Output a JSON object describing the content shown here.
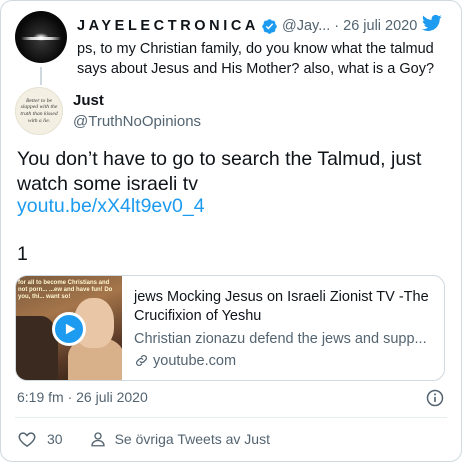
{
  "parent_tweet": {
    "display_name": "JAYELECTRONICA",
    "handle": "@Jay...",
    "separator": "·",
    "date": "26 juli 2020",
    "text": "ps, to my Christian family, do you know what the talmud says about Jesus and His Mother? also, what is a Goy?"
  },
  "tweet": {
    "display_name": "Just",
    "handle": "@TruthNoOpinions",
    "avatar_text": "Better to be slapped with the truth than kissed with a lie.",
    "text": "You don’t have to go to search the Talmud, just watch some israeli tv",
    "link_text": "youtu.be/xX4lt9ev0_4",
    "trailing_text": "1",
    "link_card": {
      "thumbnail_caption": "for all to become Christians and not porn... ...ew and have fun! Do you, thi... want so!",
      "title": "jews Mocking Jesus on Israeli Zionist TV -The Crucifixion of Yeshu",
      "description": "Christian zionazu defend the jews and supp...",
      "domain": "youtube.com"
    },
    "timestamp": "6:19 fm · 26 juli 2020",
    "like_count": "30",
    "see_more_label": "Se övriga Tweets av Just"
  },
  "colors": {
    "accent": "#1d9bf0",
    "text_primary": "#0f1419",
    "text_secondary": "#536471",
    "border": "#cfd9de"
  },
  "icons": {
    "verified": "verified-badge-icon",
    "bird": "twitter-bird-icon",
    "play": "play-icon",
    "link": "link-icon",
    "info": "info-icon",
    "like": "heart-icon",
    "person": "person-icon"
  }
}
